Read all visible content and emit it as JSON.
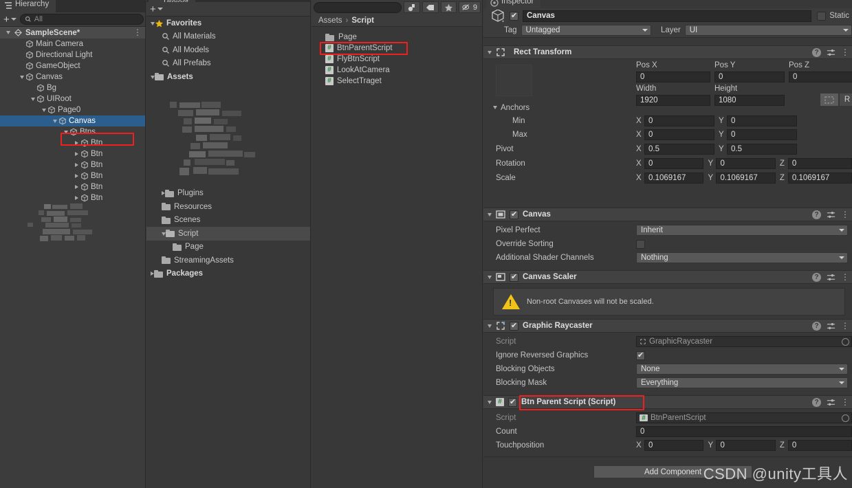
{
  "hierarchy": {
    "tab_label": "Hierarchy",
    "search_placeholder": "All",
    "scene_name": "SampleScene*",
    "items": [
      {
        "label": "Main Camera",
        "depth": 1,
        "twisty": "none"
      },
      {
        "label": "Directional Light",
        "depth": 1,
        "twisty": "none"
      },
      {
        "label": "GameObject",
        "depth": 1,
        "twisty": "none"
      },
      {
        "label": "Canvas",
        "depth": 1,
        "twisty": "down"
      },
      {
        "label": "Bg",
        "depth": 2,
        "twisty": "none"
      },
      {
        "label": "UIRoot",
        "depth": 2,
        "twisty": "down"
      },
      {
        "label": "Page0",
        "depth": 3,
        "twisty": "down"
      },
      {
        "label": "Canvas",
        "depth": 4,
        "twisty": "down",
        "selected": true,
        "highlighted": true
      },
      {
        "label": "Btns",
        "depth": 5,
        "twisty": "down"
      },
      {
        "label": "Btn",
        "depth": 6,
        "twisty": "right"
      },
      {
        "label": "Btn",
        "depth": 6,
        "twisty": "right"
      },
      {
        "label": "Btn",
        "depth": 6,
        "twisty": "right"
      },
      {
        "label": "Btn",
        "depth": 6,
        "twisty": "right"
      },
      {
        "label": "Btn",
        "depth": 6,
        "twisty": "right"
      },
      {
        "label": "Btn",
        "depth": 6,
        "twisty": "right"
      }
    ]
  },
  "project": {
    "tab_label": "Project",
    "search_placeholder": "",
    "toolbar_icons": [
      "object-filter-icon",
      "label-filter-icon",
      "favorite-star-icon",
      "hidden-eye-icon"
    ],
    "hidden_count": "9",
    "tree": [
      {
        "label": "Favorites",
        "depth": 0,
        "twisty": "down",
        "icon": "star-icon",
        "bold": true
      },
      {
        "label": "All Materials",
        "depth": 1,
        "twisty": "none",
        "icon": "search-icon"
      },
      {
        "label": "All Models",
        "depth": 1,
        "twisty": "none",
        "icon": "search-icon"
      },
      {
        "label": "All Prefabs",
        "depth": 1,
        "twisty": "none",
        "icon": "search-icon"
      },
      {
        "label": "Assets",
        "depth": 0,
        "twisty": "down",
        "icon": "folder-open-icon",
        "bold": true
      },
      {
        "label": "Plugins",
        "depth": 1,
        "twisty": "right",
        "icon": "folder-icon"
      },
      {
        "label": "Resources",
        "depth": 1,
        "twisty": "none",
        "icon": "folder-icon"
      },
      {
        "label": "Scenes",
        "depth": 1,
        "twisty": "none",
        "icon": "folder-icon"
      },
      {
        "label": "Script",
        "depth": 1,
        "twisty": "down",
        "icon": "folder-open-icon",
        "selected": true
      },
      {
        "label": "Page",
        "depth": 2,
        "twisty": "none",
        "icon": "folder-icon"
      },
      {
        "label": "StreamingAssets",
        "depth": 1,
        "twisty": "none",
        "icon": "folder-icon"
      },
      {
        "label": "Packages",
        "depth": 0,
        "twisty": "right",
        "icon": "folder-icon",
        "bold": true
      }
    ]
  },
  "assets": {
    "breadcrumb": [
      "Assets",
      "Script"
    ],
    "breadcrumb_separator": "›",
    "rows": [
      {
        "label": "Page",
        "icon": "folder-icon"
      },
      {
        "label": "BtnParentScript",
        "icon": "csharp-script-icon",
        "highlighted": true
      },
      {
        "label": "FlyBtnScript",
        "icon": "csharp-script-icon"
      },
      {
        "label": "LookAtCamera",
        "icon": "csharp-script-icon"
      },
      {
        "label": "SelectTraget",
        "icon": "csharp-script-icon"
      }
    ]
  },
  "inspector": {
    "tab_label": "Inspector",
    "object_name": "Canvas",
    "object_enabled": true,
    "static_label": "Static",
    "static_checked": false,
    "tag_label": "Tag",
    "tag_value": "Untagged",
    "layer_label": "Layer",
    "layer_value": "UI",
    "components": [
      {
        "name": "rect-transform",
        "title": "Rect Transform",
        "icon": "rect-transform-icon",
        "has_enable_checkbox": false,
        "fields": {
          "pos_headers": [
            "Pos X",
            "Pos Y",
            "Pos Z"
          ],
          "pos_values": [
            "0",
            "0",
            "0"
          ],
          "size_headers": [
            "Width",
            "Height"
          ],
          "size_values": [
            "1920",
            "1080"
          ],
          "blueprint_button": "blueprint-mode-icon",
          "raw_button": "R",
          "anchors_label": "Anchors",
          "min_label": "Min",
          "min_values": [
            "0",
            "0"
          ],
          "max_label": "Max",
          "max_values": [
            "0",
            "0"
          ],
          "pivot_label": "Pivot",
          "pivot_values": [
            "0.5",
            "0.5"
          ],
          "rotation_label": "Rotation",
          "rotation_values": [
            "0",
            "0",
            "0"
          ],
          "scale_label": "Scale",
          "scale_values": [
            "0.1069167",
            "0.1069167",
            "0.1069167"
          ],
          "axis_labels": [
            "X",
            "Y",
            "Z"
          ]
        }
      },
      {
        "name": "canvas",
        "title": "Canvas",
        "icon": "canvas-icon",
        "has_enable_checkbox": true,
        "enabled": true,
        "rows": [
          {
            "label": "Pixel Perfect",
            "type": "dropdown",
            "value": "Inherit"
          },
          {
            "label": "Override Sorting",
            "type": "checkbox",
            "value": false
          },
          {
            "label": "Additional Shader Channels",
            "type": "dropdown",
            "value": "Nothing"
          }
        ]
      },
      {
        "name": "canvas-scaler",
        "title": "Canvas Scaler",
        "icon": "canvas-scaler-icon",
        "has_enable_checkbox": true,
        "enabled": true,
        "warning": "Non-root Canvases will not be scaled."
      },
      {
        "name": "graphic-raycaster",
        "title": "Graphic Raycaster",
        "icon": "graphic-raycaster-icon",
        "has_enable_checkbox": true,
        "enabled": true,
        "rows": [
          {
            "label": "Script",
            "type": "object",
            "value": "GraphicRaycaster",
            "dim": true
          },
          {
            "label": "Ignore Reversed Graphics",
            "type": "checkbox",
            "value": true
          },
          {
            "label": "Blocking Objects",
            "type": "dropdown",
            "value": "None"
          },
          {
            "label": "Blocking Mask",
            "type": "dropdown",
            "value": "Everything"
          }
        ]
      },
      {
        "name": "btn-parent-script",
        "title": "Btn Parent Script (Script)",
        "icon": "csharp-script-icon",
        "has_enable_checkbox": true,
        "enabled": true,
        "highlighted": true,
        "rows": [
          {
            "label": "Script",
            "type": "object",
            "value": "BtnParentScript",
            "dim": true
          },
          {
            "label": "Count",
            "type": "text",
            "value": "0"
          },
          {
            "label": "Touchposition",
            "type": "vector3",
            "value": [
              "0",
              "0",
              "0"
            ],
            "axis_labels": [
              "X",
              "Y",
              "Z"
            ]
          }
        ]
      }
    ],
    "add_component_label": "Add Component"
  },
  "watermark": "CSDN @unity工具人",
  "colors": {
    "panel_bg": "#383838",
    "header_bg": "#3c3c3c",
    "selection_blue": "#2c5e8d",
    "highlight_red": "#ef2020",
    "warning_yellow": "#f2c317",
    "script_green": "#2c8a3c"
  }
}
